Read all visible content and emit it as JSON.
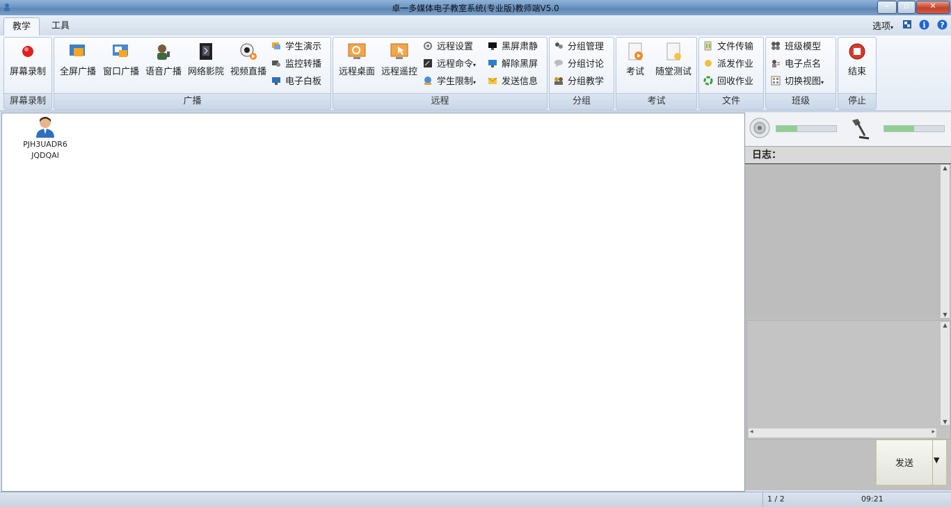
{
  "window": {
    "title": "卓一多媒体电子教室系统(专业版)教师端V5.0",
    "controls": [
      "minimize",
      "maximize",
      "close"
    ]
  },
  "tabs": [
    {
      "label": "教学",
      "active": true
    },
    {
      "label": "工具",
      "active": false
    }
  ],
  "top_right": {
    "options_label": "选项",
    "icons": [
      "config-icon",
      "info-icon",
      "help-icon"
    ]
  },
  "ribbon": {
    "groups": [
      {
        "label": "屏幕录制",
        "big_buttons": [
          "屏幕录制"
        ]
      },
      {
        "label": "广播",
        "big_buttons": [
          "全屏广播",
          "窗口广播",
          "语音广播",
          "网络影院",
          "视频直播"
        ],
        "small_buttons": [
          "学生演示",
          "监控转播",
          "电子白板"
        ]
      },
      {
        "label": "远程",
        "big_buttons": [
          "远程桌面",
          "远程遥控"
        ],
        "small_buttons": [
          "远程设置",
          "远程命令",
          "学生限制",
          "黑屏肃静",
          "解除黑屏",
          "发送信息"
        ]
      },
      {
        "label": "分组",
        "small_buttons": [
          "分组管理",
          "分组讨论",
          "分组教学"
        ]
      },
      {
        "label": "考试",
        "big_buttons": [
          "考试",
          "随堂测试"
        ]
      },
      {
        "label": "文件",
        "small_buttons": [
          "文件传输",
          "派发作业",
          "回收作业"
        ]
      },
      {
        "label": "班级",
        "small_buttons": [
          "班级模型",
          "电子点名",
          "切换视图"
        ]
      },
      {
        "label": "停止",
        "big_buttons": [
          "结束"
        ]
      }
    ]
  },
  "students": [
    {
      "name_line1": "PJH3UADR6",
      "name_line2": "JQDQAI"
    }
  ],
  "right_panel": {
    "speaker_level": 0.35,
    "mic_level": 0.5,
    "log_label": "日志：",
    "send_label": "发送"
  },
  "status_bar": {
    "page": "1 / 2",
    "time": "09:21"
  }
}
